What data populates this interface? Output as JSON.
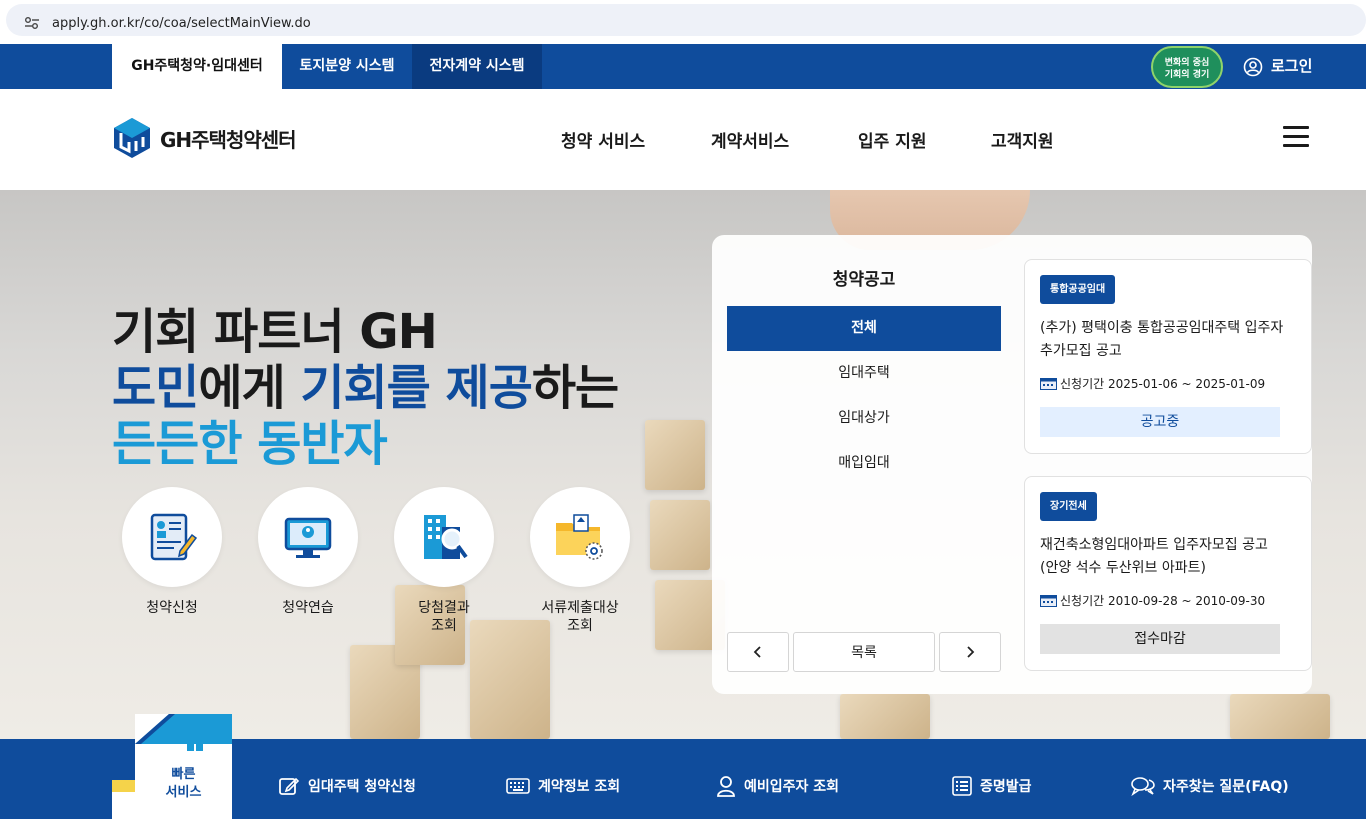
{
  "browser": {
    "url": "apply.gh.or.kr/co/coa/selectMainView.do"
  },
  "topbar": {
    "tabs": [
      {
        "label": "GH주택청약·임대센터"
      },
      {
        "label": "토지분양 시스템"
      },
      {
        "label": "전자계약 시스템"
      }
    ],
    "badge_line1": "변화의 중심",
    "badge_line2": "기회의 경기",
    "login_label": "로그인"
  },
  "header": {
    "logo_text": "GH주택청약센터",
    "nav": [
      "청약 서비스",
      "계약서비스",
      "입주 지원",
      "고객지원"
    ]
  },
  "hero": {
    "line1": "기회 파트너 GH",
    "line2_a": "도민",
    "line2_b": "에게 ",
    "line2_c": "기회를 제공",
    "line2_d": "하는",
    "line3": "든든한 동반자",
    "quick": [
      {
        "label": "청약신청",
        "icon": "application-form-icon"
      },
      {
        "label": "청약연습",
        "icon": "monitor-user-icon"
      },
      {
        "label": "당첨결과\n조회",
        "icon": "building-search-icon"
      },
      {
        "label": "서류제출대상\n조회",
        "icon": "folder-search-icon"
      }
    ]
  },
  "notice": {
    "title": "청약공고",
    "categories": [
      "전체",
      "임대주택",
      "임대상가",
      "매입임대"
    ],
    "list_label": "목록",
    "cards": [
      {
        "tag": "통합공공임대",
        "title": "(추가) 평택이충 통합공공임대주택 입주자 추가모집 공고",
        "period": "신청기간 2025-01-06 ~ 2025-01-09",
        "status": "공고중"
      },
      {
        "tag": "장기전세",
        "title": "재건축소형임대아파트 입주자모집 공고(안양 석수 두산위브 아파트)",
        "period": "신청기간 2010-09-28 ~ 2010-09-30",
        "status": "접수마감"
      }
    ]
  },
  "quickbar": {
    "label_line1": "빠른",
    "label_line2": "서비스",
    "links": [
      {
        "label": "임대주택 청약신청",
        "icon": "edit-icon"
      },
      {
        "label": "계약정보 조회",
        "icon": "keyboard-icon"
      },
      {
        "label": "예비입주자 조회",
        "icon": "user-icon"
      },
      {
        "label": "증명발급",
        "icon": "list-icon"
      },
      {
        "label": "자주찾는 질문(FAQ)",
        "icon": "chat-icon"
      }
    ]
  },
  "colors": {
    "brand": "#0f4c9c",
    "accent": "#1b9ad6"
  }
}
